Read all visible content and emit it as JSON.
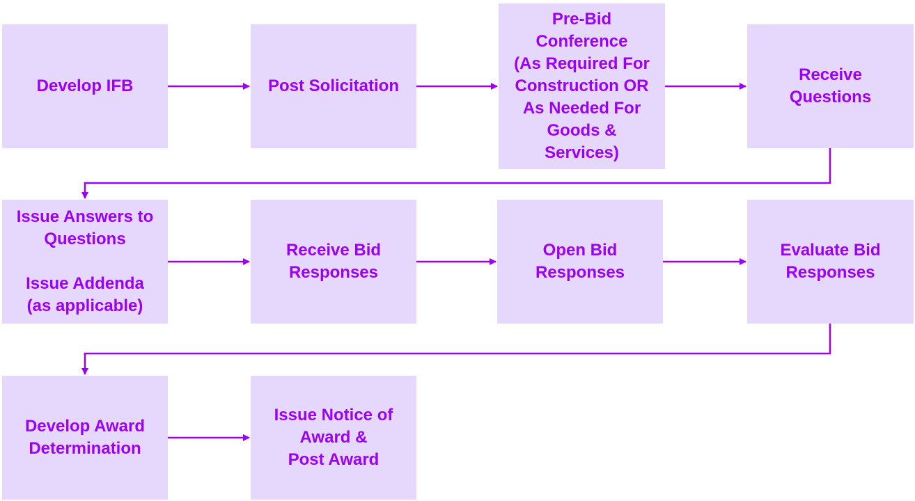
{
  "colors": {
    "box_fill": "#E6D8FC",
    "accent": "#9B00F5"
  },
  "steps": [
    {
      "label": "Develop IFB"
    },
    {
      "label": "Post Solicitation"
    },
    {
      "label": "Pre-Bid\nConference\n(As Required For\nConstruction OR\nAs Needed For\nGoods &\nServices)"
    },
    {
      "label": "Receive\nQuestions"
    },
    {
      "label": "Issue Answers to\nQuestions\n\nIssue Addenda\n(as applicable)"
    },
    {
      "label": "Receive Bid\nResponses"
    },
    {
      "label": "Open Bid\nResponses"
    },
    {
      "label": "Evaluate Bid\nResponses"
    },
    {
      "label": "Develop Award\nDetermination"
    },
    {
      "label": "Issue Notice of\nAward &\nPost Award"
    }
  ]
}
